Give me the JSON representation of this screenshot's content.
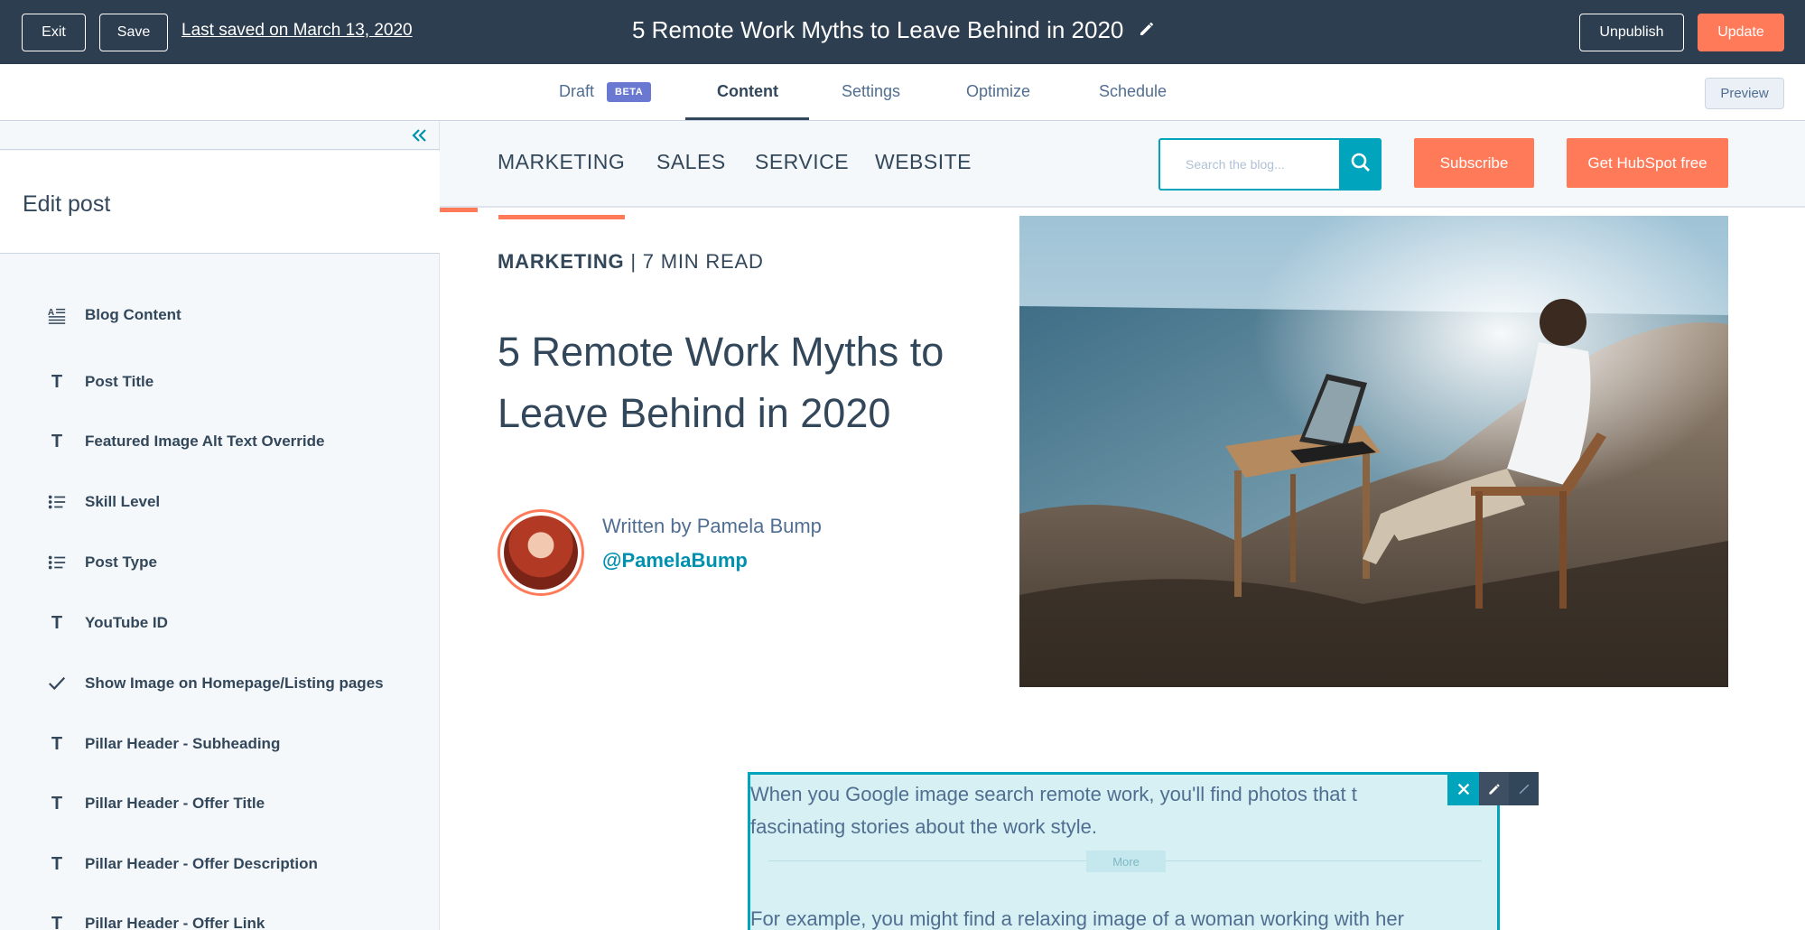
{
  "topbar": {
    "exit_label": "Exit",
    "save_label": "Save",
    "last_saved": "Last saved on March 13, 2020",
    "title": "5 Remote Work Myths to Leave Behind in 2020",
    "unpublish_label": "Unpublish",
    "update_label": "Update"
  },
  "tabs": {
    "draft": "Draft",
    "beta_badge": "BETA",
    "content": "Content",
    "settings": "Settings",
    "optimize": "Optimize",
    "schedule": "Schedule",
    "preview_label": "Preview"
  },
  "sidebar": {
    "heading": "Edit post",
    "items": [
      {
        "label": "Blog Content",
        "icon": "rich-text-icon"
      },
      {
        "label": "Post Title",
        "icon": "text-icon"
      },
      {
        "label": "Featured Image Alt Text Override",
        "icon": "text-icon"
      },
      {
        "label": "Skill Level",
        "icon": "choice-icon"
      },
      {
        "label": "Post Type",
        "icon": "choice-icon"
      },
      {
        "label": "YouTube ID",
        "icon": "text-icon"
      },
      {
        "label": "Show Image on Homepage/Listing pages",
        "icon": "check-icon"
      },
      {
        "label": "Pillar Header - Subheading",
        "icon": "text-icon"
      },
      {
        "label": "Pillar Header - Offer Title",
        "icon": "text-icon"
      },
      {
        "label": "Pillar Header - Offer Description",
        "icon": "text-icon"
      },
      {
        "label": "Pillar Header - Offer Link",
        "icon": "text-icon"
      }
    ]
  },
  "blog": {
    "nav": [
      "MARKETING",
      "SALES",
      "SERVICE",
      "WEBSITE"
    ],
    "search_placeholder": "Search the blog...",
    "subscribe_label": "Subscribe",
    "get_hubspot_label": "Get HubSpot free",
    "meta_category": "MARKETING",
    "meta_sep": " | ",
    "meta_read": "7 MIN READ",
    "post_title": "5 Remote Work Myths to Leave Behind in 2020",
    "written_by": "Written by Pamela Bump",
    "author_handle": "@PamelaBump",
    "body_paragraph_1": "When you Google image search remote work, you'll find photos that t fascinating stories about the work style.",
    "more_label": "More",
    "body_paragraph_2": "For example, you might find a relaxing image of a woman working with her"
  },
  "colors": {
    "topbar_bg": "#2d3e50",
    "accent_orange": "#ff7a59",
    "accent_teal": "#00a4bd",
    "beta_purple": "#6a78d1",
    "text_dark": "#33475b"
  }
}
